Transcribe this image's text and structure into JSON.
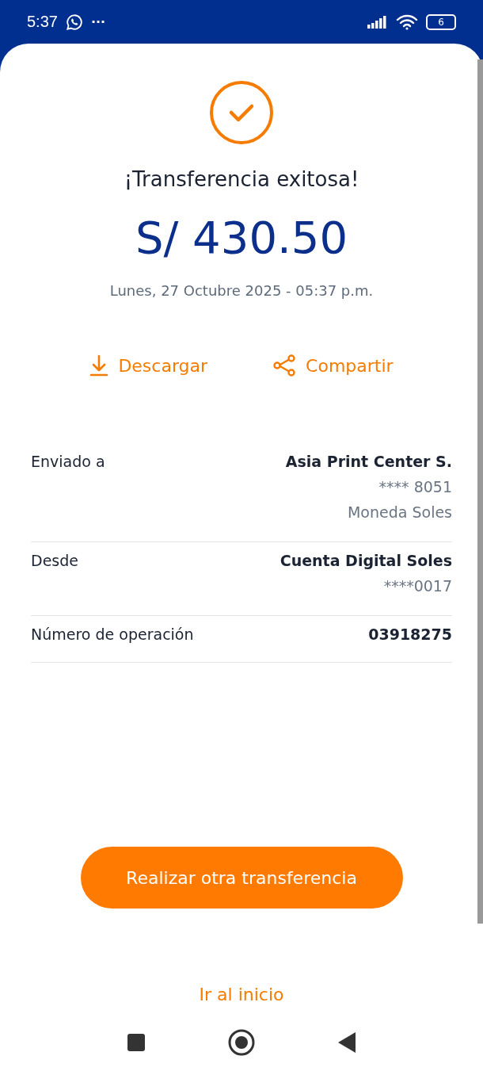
{
  "status_bar": {
    "time": "5:37",
    "more": "···",
    "battery": "6"
  },
  "result": {
    "title": "¡Transferencia exitosa!",
    "amount": "S/ 430.50",
    "date": "Lunes, 27 Octubre 2025 - 05:37 p.m."
  },
  "actions": [
    {
      "kind": "download",
      "label": "Descargar"
    },
    {
      "kind": "share",
      "label": "Compartir"
    }
  ],
  "details": [
    {
      "label": "Enviado a",
      "lines": [
        {
          "kind": "primary",
          "text": "Asia Print Center S."
        },
        {
          "kind": "secondary",
          "text": "**** 8051"
        },
        {
          "kind": "secondary",
          "text": "Moneda Soles"
        }
      ]
    },
    {
      "label": "Desde",
      "lines": [
        {
          "kind": "primary",
          "text": "Cuenta Digital Soles"
        },
        {
          "kind": "secondary",
          "text": "****0017"
        }
      ]
    },
    {
      "label": "Número de operación",
      "lines": [
        {
          "kind": "primary",
          "text": "03918275"
        }
      ]
    }
  ],
  "primary_button": "Realizar otra transferencia",
  "secondary_link": "Ir al inicio"
}
